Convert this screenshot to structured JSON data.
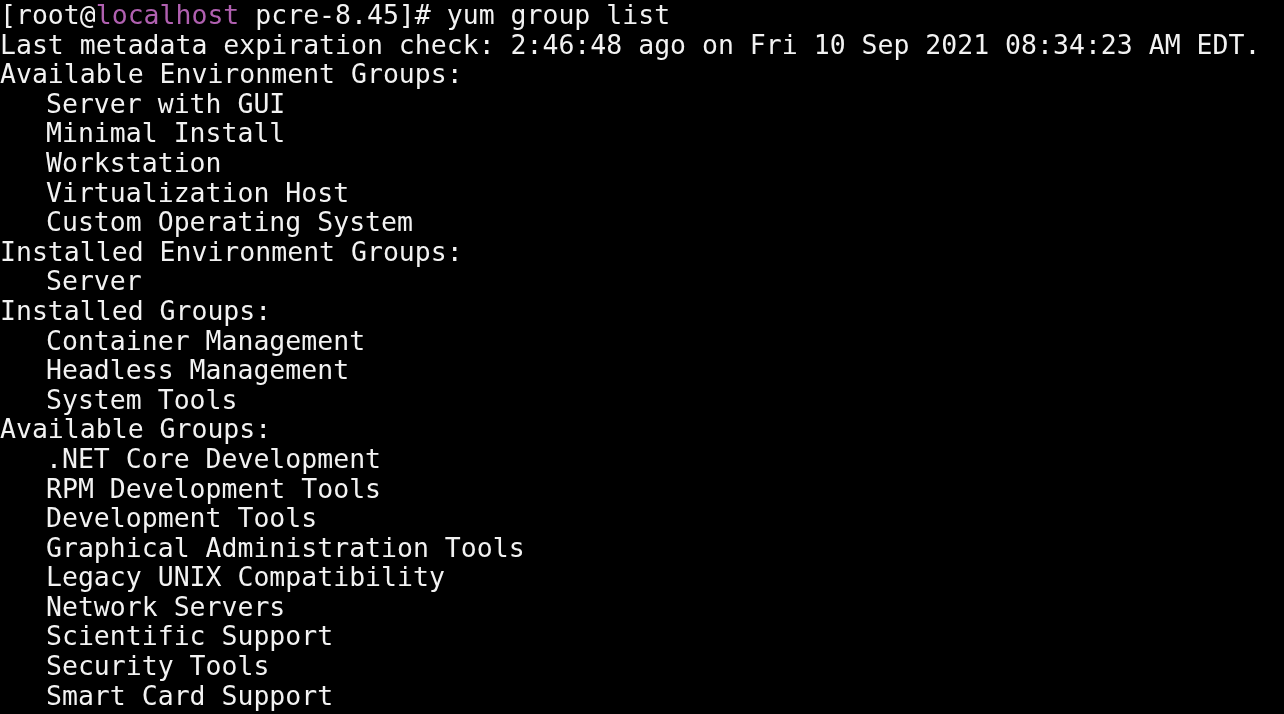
{
  "prompt": {
    "open": "[root@",
    "host": "localhost",
    "rest": " pcre-8.45]# yum group list"
  },
  "lines": [
    {
      "kind": "info",
      "text": "Last metadata expiration check: 2:46:48 ago on Fri 10 Sep 2021 08:34:23 AM EDT."
    },
    {
      "kind": "heading",
      "text": "Available Environment Groups:"
    },
    {
      "kind": "item",
      "text": "Server with GUI"
    },
    {
      "kind": "item",
      "text": "Minimal Install"
    },
    {
      "kind": "item",
      "text": "Workstation"
    },
    {
      "kind": "item",
      "text": "Virtualization Host"
    },
    {
      "kind": "item",
      "text": "Custom Operating System"
    },
    {
      "kind": "heading",
      "text": "Installed Environment Groups:"
    },
    {
      "kind": "item",
      "text": "Server"
    },
    {
      "kind": "heading",
      "text": "Installed Groups:"
    },
    {
      "kind": "item",
      "text": "Container Management"
    },
    {
      "kind": "item",
      "text": "Headless Management"
    },
    {
      "kind": "item",
      "text": "System Tools"
    },
    {
      "kind": "heading",
      "text": "Available Groups:"
    },
    {
      "kind": "item",
      "text": ".NET Core Development"
    },
    {
      "kind": "item",
      "text": "RPM Development Tools"
    },
    {
      "kind": "item",
      "text": "Development Tools"
    },
    {
      "kind": "item",
      "text": "Graphical Administration Tools"
    },
    {
      "kind": "item",
      "text": "Legacy UNIX Compatibility"
    },
    {
      "kind": "item",
      "text": "Network Servers"
    },
    {
      "kind": "item",
      "text": "Scientific Support"
    },
    {
      "kind": "item",
      "text": "Security Tools"
    },
    {
      "kind": "item",
      "text": "Smart Card Support"
    }
  ]
}
